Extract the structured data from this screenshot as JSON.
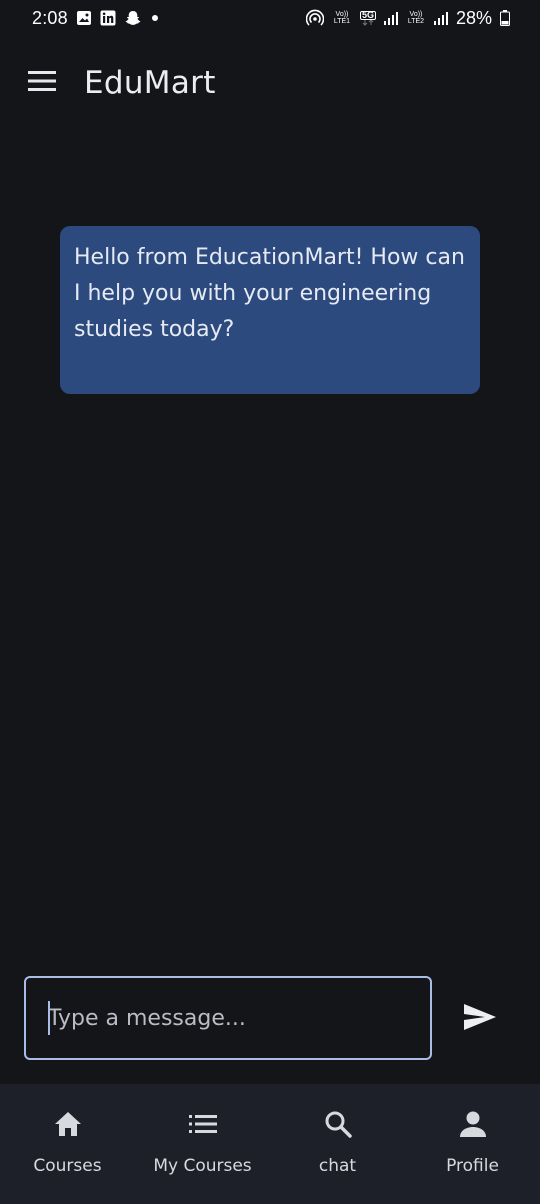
{
  "status_bar": {
    "time": "2:08",
    "left_icons": [
      "gallery-icon",
      "linkedin-icon",
      "snapchat-icon",
      "dot-icon"
    ],
    "right_icons": [
      "hotspot-icon",
      "volte1-icon",
      "5g-icon",
      "signal1-icon",
      "volte2-icon",
      "signal2-icon",
      "battery-icon"
    ],
    "volte1_label": "Vo)) LTE1",
    "fiveg_label": "5G",
    "volte2_label": "Vo)) LTE2",
    "battery": "28%"
  },
  "app_bar": {
    "title": "EduMart",
    "menu_icon": "menu-icon"
  },
  "chat": {
    "messages": [
      {
        "sender": "bot",
        "text": "Hello from EducationMart! How can I help you with your engineering studies today?"
      }
    ]
  },
  "input": {
    "placeholder": "Type a message...",
    "value": "",
    "send_icon": "send-icon"
  },
  "bottom_nav": {
    "items": [
      {
        "label": "Courses",
        "icon": "home-icon"
      },
      {
        "label": "My Courses",
        "icon": "list-icon"
      },
      {
        "label": "chat",
        "icon": "search-icon"
      },
      {
        "label": "Profile",
        "icon": "person-icon"
      }
    ]
  },
  "colors": {
    "background": "#141519",
    "bubble": "#2d4a7f",
    "input_border": "#a9bde6",
    "nav_background": "#1e2029"
  }
}
